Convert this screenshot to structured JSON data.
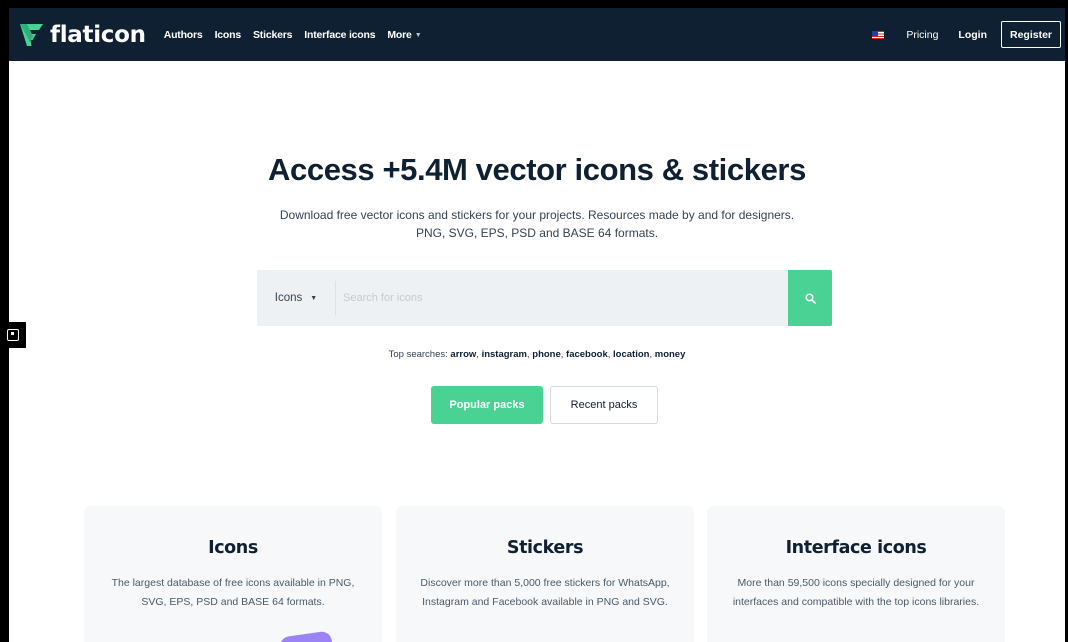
{
  "nav": {
    "logo_text": "flaticon",
    "links": [
      {
        "label": "Authors"
      },
      {
        "label": "Icons"
      },
      {
        "label": "Stickers"
      },
      {
        "label": "Interface icons"
      },
      {
        "label": "More"
      }
    ],
    "pricing": "Pricing",
    "login": "Login",
    "register": "Register"
  },
  "hero": {
    "title": "Access +5.4M vector icons & stickers",
    "subtitle_line1": "Download free vector icons and stickers for your projects. Resources made by and for designers.",
    "subtitle_line2": "PNG, SVG, EPS, PSD and BASE 64 formats."
  },
  "search": {
    "type_label": "Icons",
    "placeholder": "Search for icons"
  },
  "top_searches": {
    "label": "Top searches:",
    "items": [
      "arrow",
      "instagram",
      "phone",
      "facebook",
      "location",
      "money"
    ]
  },
  "packs": {
    "popular": "Popular packs",
    "recent": "Recent packs"
  },
  "cards": [
    {
      "title": "Icons",
      "desc": "The largest database of free icons available in PNG, SVG, EPS, PSD and BASE 64 formats."
    },
    {
      "title": "Stickers",
      "desc": "Discover more than 5,000 free stickers for WhatsApp, Instagram and Facebook available in PNG and SVG."
    },
    {
      "title": "Interface icons",
      "desc": "More than 59,500 icons specially designed for your interfaces and compatible with the top icons libraries."
    }
  ],
  "colors": {
    "nav_bg": "#0e2032",
    "accent": "#4ad295",
    "text_dark": "#0e2032"
  }
}
